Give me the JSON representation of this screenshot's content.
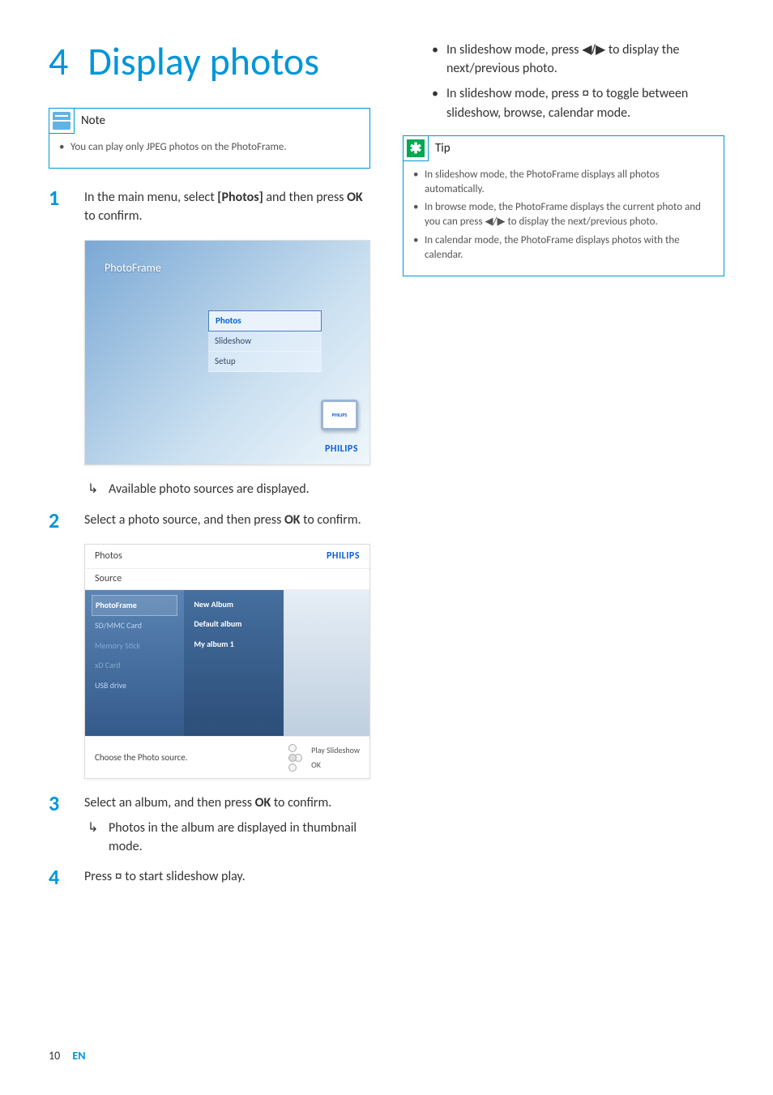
{
  "chapter": {
    "number": "4",
    "title": "Display photos"
  },
  "note": {
    "label": "Note",
    "items": [
      "You can play only JPEG photos on the PhotoFrame."
    ]
  },
  "steps": {
    "s1": {
      "num": "1",
      "text_a": "In the main menu, select ",
      "bold_a": "[Photos]",
      "text_b": " and then press ",
      "bold_b": "OK",
      "text_c": " to confirm.",
      "result": "Available photo sources are displayed."
    },
    "s2": {
      "num": "2",
      "text_a": "Select a photo source, and then press ",
      "bold_a": "OK",
      "text_b": " to confirm."
    },
    "s3": {
      "num": "3",
      "text_a": "Select an album, and then press ",
      "bold_a": "OK",
      "text_b": " to confirm.",
      "result": "Photos in the album are displayed in thumbnail mode."
    },
    "s4": {
      "num": "4",
      "text_a": "Press ",
      "icon": "¤",
      "text_b": " to start slideshow play."
    }
  },
  "right_bullets": {
    "b1_a": "In slideshow mode, press ",
    "b1_sym": "◀/▶",
    "b1_b": " to display the next/previous photo.",
    "b2_a": "In slideshow mode, press ",
    "b2_icon": "¤",
    "b2_b": " to toggle between slideshow, browse, calendar mode."
  },
  "tip": {
    "label": "Tip",
    "items": [
      "In slideshow mode, the PhotoFrame displays all photos automatically.",
      "In browse mode, the PhotoFrame displays the current photo and you can press ◀/▶ to display the next/previous photo.",
      "In calendar mode, the PhotoFrame displays photos with the calendar."
    ]
  },
  "screenshot1": {
    "title": "PhotoFrame",
    "menu": [
      "Photos",
      "Slideshow",
      "Setup"
    ],
    "brand": "PHILIPS",
    "device_brand": "PHILIPS"
  },
  "screenshot2": {
    "top_title": "Photos",
    "brand": "PHILIPS",
    "sub": "Source",
    "sources": [
      {
        "label": "PhotoFrame",
        "state": "sel"
      },
      {
        "label": "SD/MMC Card",
        "state": ""
      },
      {
        "label": "Memory Stick",
        "state": "dim"
      },
      {
        "label": "xD Card",
        "state": "dim"
      },
      {
        "label": "USB drive",
        "state": ""
      }
    ],
    "albums": [
      "New Album",
      "Default album",
      "My album 1"
    ],
    "hint": "Choose the Photo source.",
    "ctrl1": "Play Slideshow",
    "ctrl2": "OK"
  },
  "footer": {
    "page": "10",
    "lang": "EN"
  }
}
